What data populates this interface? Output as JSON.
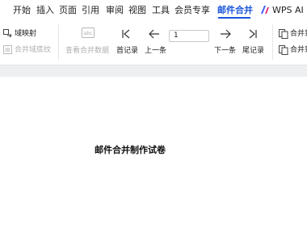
{
  "menu": {
    "tabs": [
      {
        "label": "开始"
      },
      {
        "label": "插入"
      },
      {
        "label": "页面"
      },
      {
        "label": "引用"
      },
      {
        "label": "审阅"
      },
      {
        "label": "视图"
      },
      {
        "label": "工具"
      },
      {
        "label": "会员专享"
      },
      {
        "label": "邮件合并"
      },
      {
        "label": "WPS AI"
      }
    ],
    "active_tab": "邮件合并",
    "accent_color": "#1a56db"
  },
  "ribbon": {
    "field_mapping_label": "域映射",
    "merge_field_shading_label": "合并域底纹",
    "view_merged_data_label": "查看合并数据",
    "first_record_label": "首记录",
    "previous_label": "上一条",
    "record_number_value": "1",
    "next_label": "下一条",
    "last_record_label": "尾记录",
    "merge_top_label": "合并到",
    "merge_bottom_label": "合并到"
  },
  "document": {
    "title": "邮件合并制作试卷"
  },
  "icons": [
    "field-mapping-icon",
    "merge-shading-icon",
    "view-data-icon",
    "first-record-icon",
    "previous-record-icon",
    "next-record-icon",
    "last-record-icon",
    "merge-to-document-icon",
    "merge-to-new-icon",
    "wps-ai-icon"
  ]
}
